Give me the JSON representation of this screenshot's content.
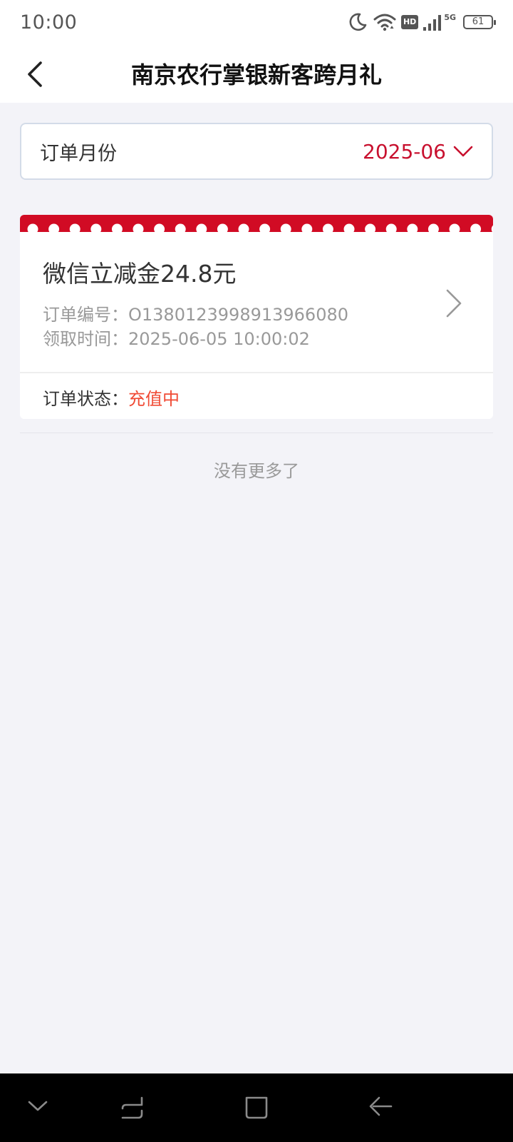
{
  "status_bar": {
    "time": "10:00",
    "hd_badge": "HD",
    "network": "5G",
    "battery": "61",
    "icons": [
      "moon-icon",
      "wifi-icon",
      "hd-icon",
      "signal-icon",
      "battery-icon"
    ]
  },
  "header": {
    "title": "南京农行掌银新客跨月礼",
    "back_icon": "back-arrow-icon"
  },
  "filter": {
    "label": "订单月份",
    "value": "2025-06",
    "icon": "chevron-down-icon"
  },
  "orders": [
    {
      "title": "微信立减金24.8元",
      "order_no_label": "订单编号：",
      "order_no": "O1380123998913966080",
      "time_label": "领取时间：",
      "time": "2025-06-05 10:00:02",
      "status_label": "订单状态：",
      "status": "充值中"
    }
  ],
  "list_end_text": "没有更多了",
  "colors": {
    "accent_red": "#c8102e",
    "band_red": "#d10b24",
    "status_orange": "#f04a34",
    "page_bg": "#f3f3f8"
  },
  "system_nav": {
    "icons": [
      "chevron-down-icon",
      "recents-icon",
      "home-icon",
      "back-icon"
    ]
  }
}
